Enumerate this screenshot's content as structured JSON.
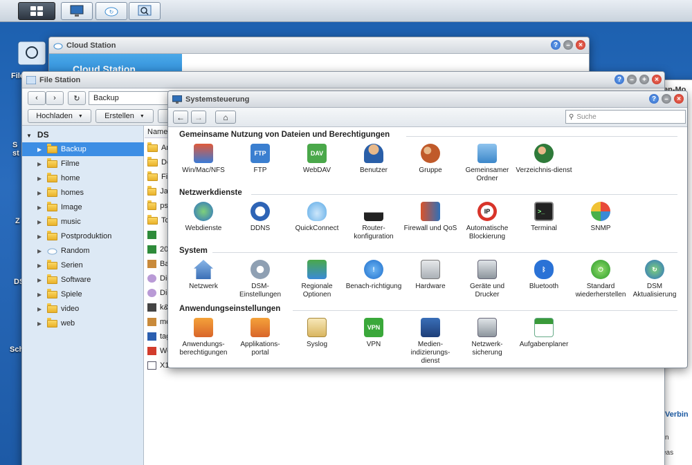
{
  "taskbar": {
    "buttons": [
      "main-menu",
      "control-panel",
      "cloud-station",
      "file-station"
    ]
  },
  "desktop": {
    "icons": [
      "File",
      "S st",
      "Z",
      "DS",
      "Sch"
    ]
  },
  "cloud": {
    "title": "Cloud Station",
    "banner": "Cloud Station"
  },
  "right_window": {
    "texts": [
      "en-Mo",
      "Verbin",
      "n",
      "eas"
    ]
  },
  "filestation": {
    "title": "File Station",
    "path": "Backup",
    "buttons": {
      "upload": "Hochladen",
      "create": "Erstellen"
    },
    "tree_root": "DS",
    "tree": [
      "Backup",
      "Filme",
      "home",
      "homes",
      "Image",
      "music",
      "Postproduktion",
      "Random",
      "Serien",
      "Software",
      "Spiele",
      "video",
      "web"
    ],
    "list_header": "Name",
    "files": [
      "An",
      "De",
      "Filr",
      "Jan",
      "psd",
      "To",
      "",
      "20",
      "Ba",
      "Die",
      "Die",
      "k&",
      "mc",
      "tag",
      "We",
      "X1"
    ]
  },
  "controlpanel": {
    "title": "Systemsteuerung",
    "search_placeholder": "Suche",
    "sections": [
      {
        "title": "Gemeinsame Nutzung von Dateien und Berechtigungen",
        "items": [
          {
            "label": "Win/Mac/NFS",
            "icon": "monitor-icon"
          },
          {
            "label": "FTP",
            "icon": "ftp-icon"
          },
          {
            "label": "WebDAV",
            "icon": "webdav-icon"
          },
          {
            "label": "Benutzer",
            "icon": "user-icon"
          },
          {
            "label": "Gruppe",
            "icon": "group-icon"
          },
          {
            "label": "Gemeinsamer Ordner",
            "icon": "shared-folder-icon"
          },
          {
            "label": "Verzeichnis-dienst",
            "icon": "directory-service-icon"
          }
        ]
      },
      {
        "title": "Netzwerkdienste",
        "items": [
          {
            "label": "Webdienste",
            "icon": "globe-icon"
          },
          {
            "label": "DDNS",
            "icon": "ddns-icon"
          },
          {
            "label": "QuickConnect",
            "icon": "cloud-icon"
          },
          {
            "label": "Router-konfiguration",
            "icon": "router-icon"
          },
          {
            "label": "Firewall und QoS",
            "icon": "firewall-icon"
          },
          {
            "label": "Automatische Blockierung",
            "icon": "block-icon"
          },
          {
            "label": "Terminal",
            "icon": "terminal-icon"
          },
          {
            "label": "SNMP",
            "icon": "pie-chart-icon"
          }
        ]
      },
      {
        "title": "System",
        "items": [
          {
            "label": "Netzwerk",
            "icon": "house-icon"
          },
          {
            "label": "DSM-Einstellungen",
            "icon": "gear-icon"
          },
          {
            "label": "Regionale Optionen",
            "icon": "clock-map-icon"
          },
          {
            "label": "Benach-richtigung",
            "icon": "notification-icon"
          },
          {
            "label": "Hardware",
            "icon": "hardware-icon"
          },
          {
            "label": "Geräte und Drucker",
            "icon": "usb-device-icon"
          },
          {
            "label": "Bluetooth",
            "icon": "bluetooth-icon"
          },
          {
            "label": "Standard wiederherstellen",
            "icon": "power-icon"
          },
          {
            "label": "DSM Aktualisierung",
            "icon": "update-icon"
          }
        ]
      },
      {
        "title": "Anwendungseinstellungen",
        "items": [
          {
            "label": "Anwendungs-berechtigungen",
            "icon": "app-permission-icon"
          },
          {
            "label": "Applikations-portal",
            "icon": "app-portal-icon"
          },
          {
            "label": "Syslog",
            "icon": "syslog-icon"
          },
          {
            "label": "VPN",
            "icon": "vpn-icon"
          },
          {
            "label": "Medien-indizierungs-dienst",
            "icon": "media-index-icon"
          },
          {
            "label": "Netzwerk-sicherung",
            "icon": "network-backup-icon"
          },
          {
            "label": "Aufgabenplaner",
            "icon": "calendar-icon"
          }
        ]
      }
    ]
  }
}
